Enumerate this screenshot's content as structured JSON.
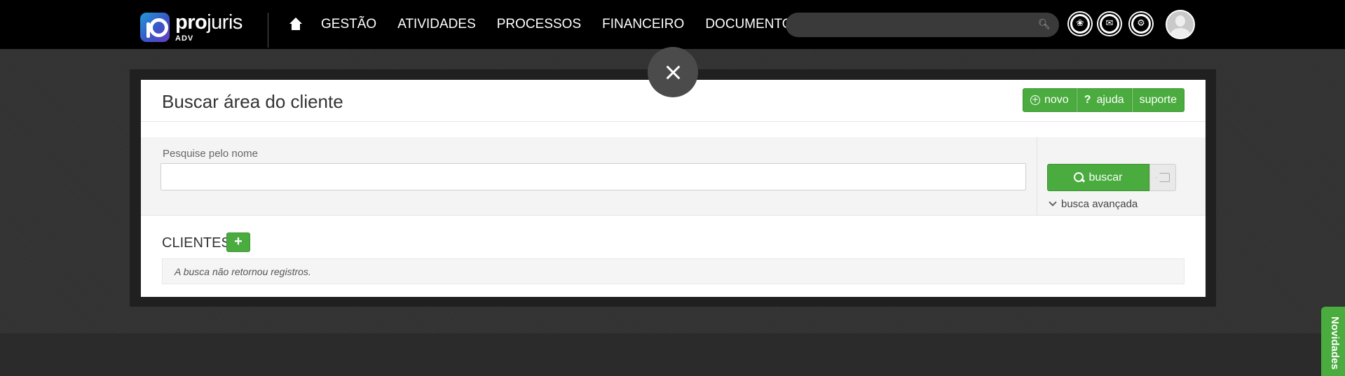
{
  "topbar": {
    "logo": {
      "word_bold": "pro",
      "word_light": "juris",
      "sub": "ADV"
    },
    "nav": [
      "GESTÃO",
      "ATIVIDADES",
      "PROCESSOS",
      "FINANCEIRO",
      "DOCUMENTOS"
    ],
    "search": {
      "value": "",
      "placeholder": ""
    },
    "icons": [
      "openai-icon",
      "mail-icon",
      "settings-icon"
    ]
  },
  "page": {
    "title": "Buscar área do cliente",
    "actions": {
      "novo": "novo",
      "ajuda": "ajuda",
      "suporte": "suporte"
    },
    "search": {
      "label": "Pesquise pelo nome",
      "value": "",
      "button": "buscar",
      "advanced": "busca avançada"
    },
    "clientes": {
      "title": "CLIENTES",
      "add": "+",
      "empty": "A busca não retornou registros."
    }
  },
  "side_tab": "Novidades",
  "colors": {
    "primary_green": "#4aab3e",
    "topbar": "#000000",
    "background": "#333333"
  }
}
